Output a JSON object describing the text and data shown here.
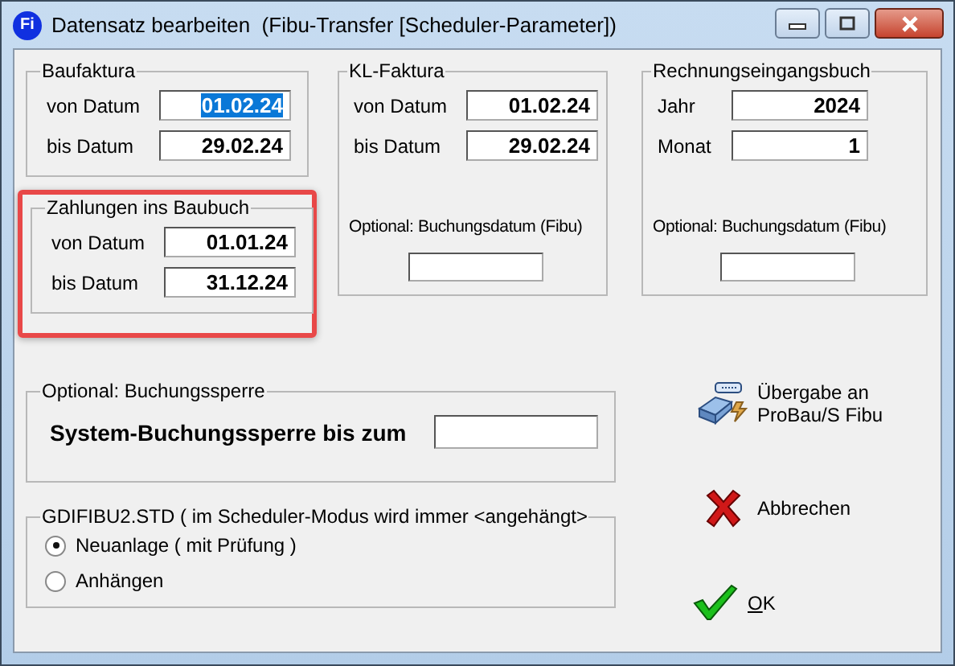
{
  "window": {
    "title": "Datensatz bearbeiten  (Fibu-Transfer [Scheduler-Parameter])",
    "logo": "Fi"
  },
  "baufaktura": {
    "title": "Baufaktura",
    "fields": [
      {
        "label": "von Datum",
        "value": "01.02.24",
        "focused": true
      },
      {
        "label": "bis Datum",
        "value": "29.02.24",
        "focused": false
      }
    ]
  },
  "kl_faktura": {
    "title": "KL-Faktura",
    "fields": [
      {
        "label": "von Datum",
        "value": "01.02.24",
        "focused": false
      },
      {
        "label": "bis Datum",
        "value": "29.02.24",
        "focused": false
      }
    ],
    "optional_label": "Optional: Buchungsdatum (Fibu)"
  },
  "rechnungseingangsbuch": {
    "title": "Rechnungseingangsbuch",
    "fields": [
      {
        "label": "Jahr",
        "value": "2024",
        "focused": false
      },
      {
        "label": "Monat",
        "value": "1",
        "focused": false
      }
    ],
    "optional_label": "Optional: Buchungsdatum (Fibu)"
  },
  "zahlungen": {
    "title": "Zahlungen ins Baubuch",
    "highlighted": true,
    "fields": [
      {
        "label": "von Datum",
        "value": "01.01.24",
        "focused": false
      },
      {
        "label": "bis Datum",
        "value": "31.12.24",
        "focused": false
      }
    ]
  },
  "buchungssperre": {
    "title": "Optional: Buchungssperre",
    "label": "System-Buchungssperre bis zum"
  },
  "mode": {
    "title": "GDIFIBU2.STD ( im Scheduler-Modus wird immer <angehängt>",
    "options": [
      {
        "label": "Neuanlage ( mit Prüfung )",
        "selected": true
      },
      {
        "label": "Anhängen",
        "selected": false
      }
    ]
  },
  "actions": [
    {
      "kind": "transfer",
      "lines": [
        "Übergabe an",
        "ProBau/S Fibu"
      ]
    },
    {
      "kind": "cancel",
      "lines": [
        "Abbrechen"
      ]
    },
    {
      "kind": "ok",
      "lines": [
        "OK"
      ],
      "underline_first": true
    }
  ]
}
